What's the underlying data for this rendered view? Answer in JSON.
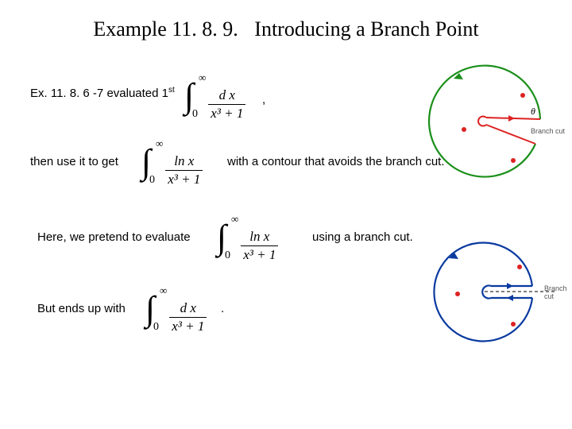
{
  "title": {
    "example": "Example 11. 8. 9.",
    "subtitle": "Introducing a Branch Point"
  },
  "line1": {
    "prefix": "Ex. 11. 8. 6 -7  evaluated 1",
    "prefix_sup": "st",
    "int": {
      "top": "∞",
      "bot": "0",
      "num": "d x",
      "den": "x³ + 1"
    },
    "suffix": ","
  },
  "line2": {
    "prefix": "then use it to get",
    "int": {
      "top": "∞",
      "bot": "0",
      "num": "ln x",
      "den": "x³ + 1"
    },
    "suffix": "with a contour that avoids the branch cut."
  },
  "line3": {
    "prefix": "Here, we pretend to evaluate",
    "int": {
      "top": "∞",
      "bot": "0",
      "num": "ln x",
      "den": "x³ + 1"
    },
    "suffix": "using a branch cut."
  },
  "line4": {
    "prefix": "But ends up with",
    "int": {
      "top": "∞",
      "bot": "0",
      "num": "d x",
      "den": "x³ + 1"
    },
    "suffix": "."
  },
  "diagrams": {
    "angle_label": "θ",
    "branch_cut1": "Branch cut",
    "branch_cut2": "Branch cut"
  }
}
